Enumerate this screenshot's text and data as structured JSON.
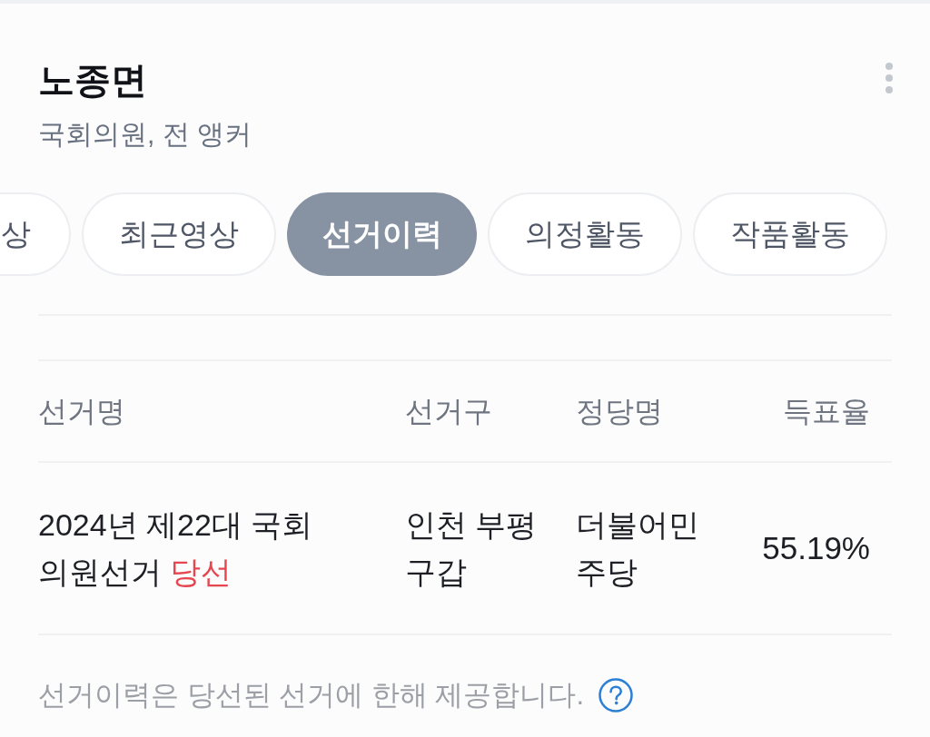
{
  "header": {
    "name": "노종면",
    "subtitle": "국회의원, 전 앵커"
  },
  "tabs": [
    {
      "label": "상",
      "selected": false
    },
    {
      "label": "최근영상",
      "selected": false
    },
    {
      "label": "선거이력",
      "selected": true
    },
    {
      "label": "의정활동",
      "selected": false
    },
    {
      "label": "작품활동",
      "selected": false
    }
  ],
  "table": {
    "columns": [
      "선거명",
      "선거구",
      "정당명",
      "득표율"
    ],
    "rows": [
      {
        "election": "2024년 제22대 국회 의원선거",
        "result": "당선",
        "district": "인천 부평구갑",
        "party": "더불어민주당",
        "vote_share": "55.19%"
      }
    ]
  },
  "footnote": "선거이력은 당선된 선거에 한해 제공합니다."
}
